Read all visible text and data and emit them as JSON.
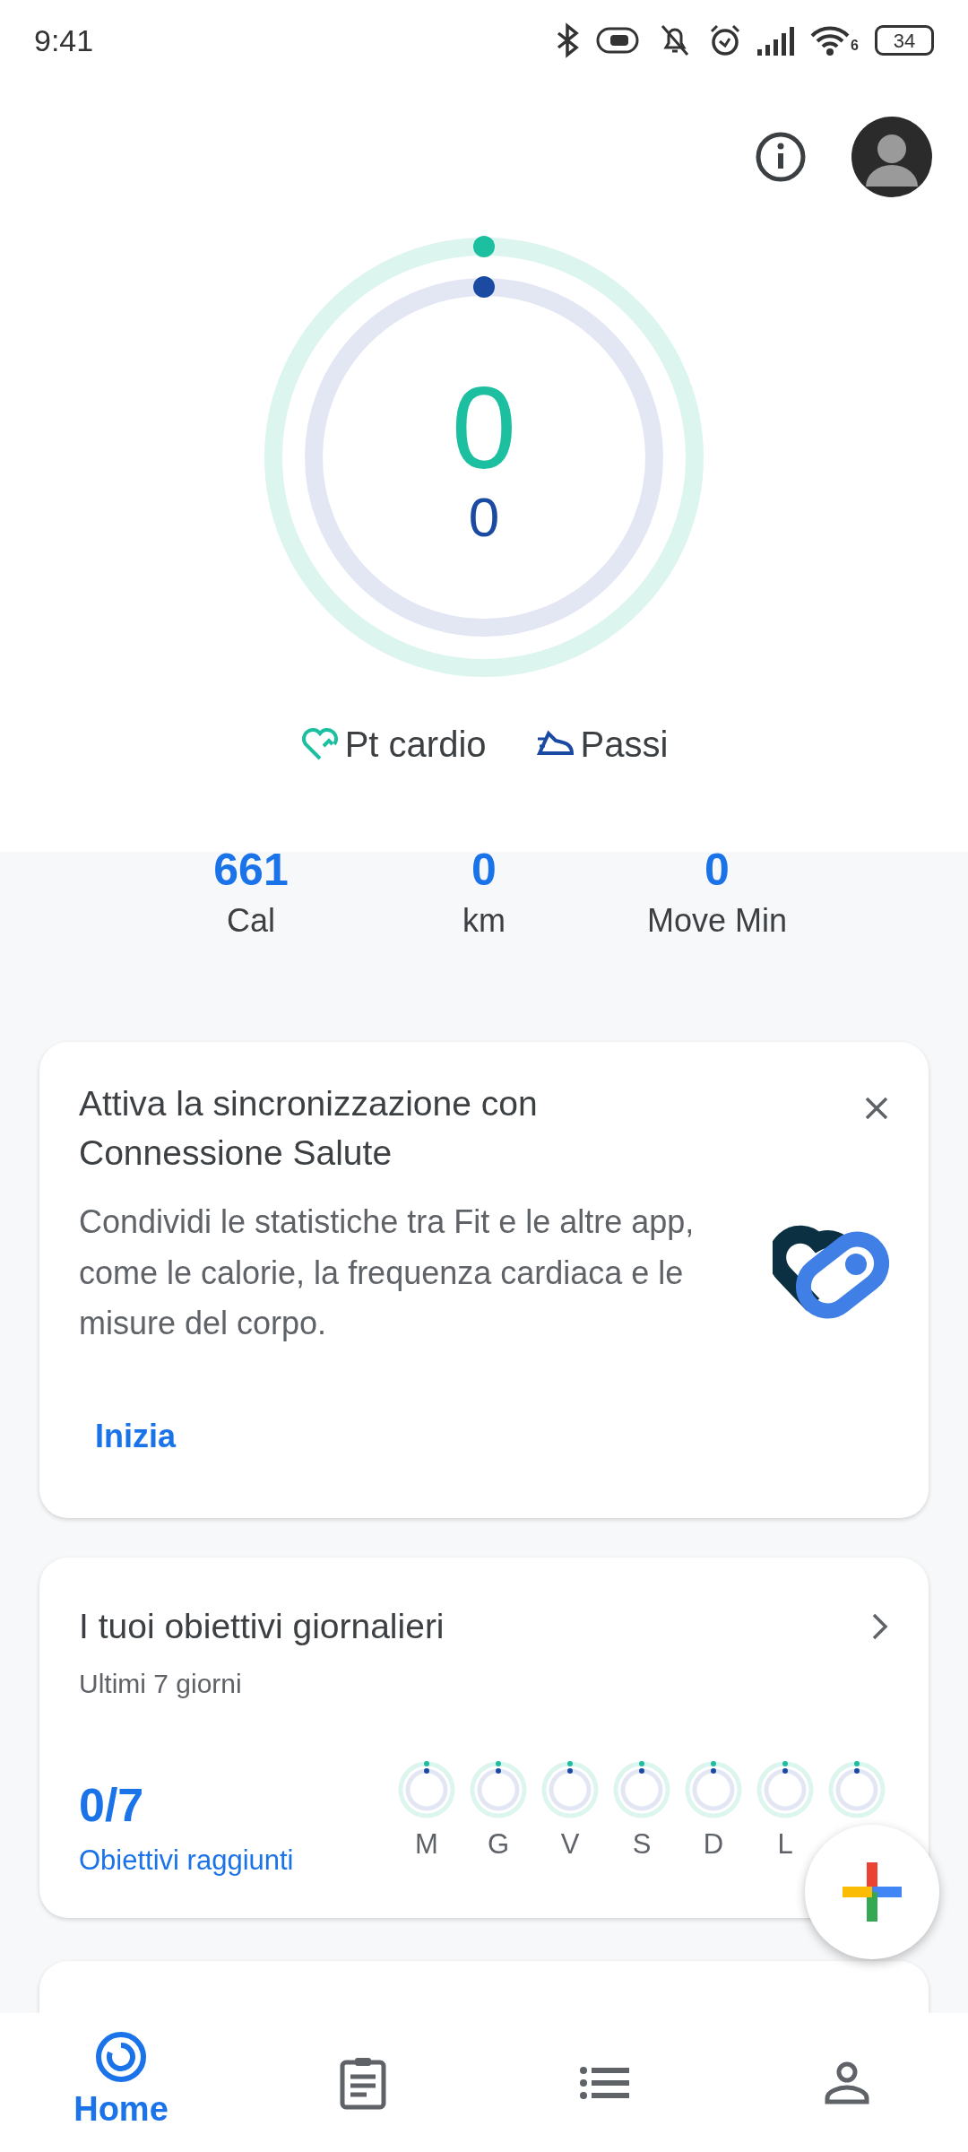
{
  "status_bar": {
    "time": "9:41",
    "wifi_label": "6",
    "battery": "34"
  },
  "rings": {
    "cardio_value": "0",
    "steps_value": "0"
  },
  "legend": [
    {
      "kind": "cardio",
      "label": "Pt cardio"
    },
    {
      "kind": "steps",
      "label": "Passi"
    }
  ],
  "stats": [
    {
      "value": "661",
      "label": "Cal"
    },
    {
      "value": "0",
      "label": "km"
    },
    {
      "value": "0",
      "label": "Move Min"
    }
  ],
  "sync_card": {
    "title": "Attiva la sincronizzazione con Connessione Salute",
    "body": "Condividi le statistiche tra Fit e le altre app, come le calorie, la frequenza cardiaca e le misure del corpo.",
    "action": "Inizia"
  },
  "goals_card": {
    "title": "I tuoi obiettivi giornalieri",
    "subtitle": "Ultimi 7 giorni",
    "count": "0/7",
    "count_label": "Obiettivi raggiunti",
    "days": [
      {
        "label": "M"
      },
      {
        "label": "G"
      },
      {
        "label": "V"
      },
      {
        "label": "S"
      },
      {
        "label": "D"
      },
      {
        "label": "L"
      },
      {
        "covered": true
      }
    ]
  },
  "nav": [
    {
      "kind": "home",
      "label": "Home",
      "selected": true
    },
    {
      "kind": "journal",
      "selected": false
    },
    {
      "kind": "browse",
      "selected": false
    },
    {
      "kind": "profile",
      "selected": false
    }
  ]
}
